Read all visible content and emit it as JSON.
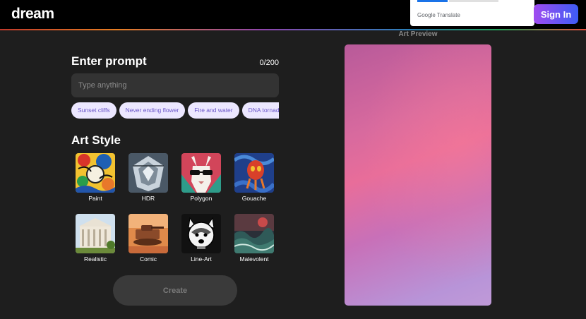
{
  "header": {
    "logo": "dream",
    "sign_in_label": "Sign In",
    "translate_popup": {
      "brand": "Google",
      "product": "Translate"
    }
  },
  "prompt": {
    "title": "Enter prompt",
    "counter": "0/200",
    "placeholder": "Type anything",
    "value": "",
    "suggestions": [
      "Sunset cliffs",
      "Never ending flower",
      "Fire and water",
      "DNA tornado"
    ]
  },
  "art_style": {
    "title": "Art Style",
    "styles": [
      {
        "label": "Paint",
        "icon": "paint-thumb"
      },
      {
        "label": "HDR",
        "icon": "hdr-thumb"
      },
      {
        "label": "Polygon",
        "icon": "polygon-thumb"
      },
      {
        "label": "Gouache",
        "icon": "gouache-thumb"
      },
      {
        "label": "Realistic",
        "icon": "realistic-thumb"
      },
      {
        "label": "Comic",
        "icon": "comic-thumb"
      },
      {
        "label": "Line-Art",
        "icon": "line-art-thumb"
      },
      {
        "label": "Malevolent",
        "icon": "malevolent-thumb"
      }
    ]
  },
  "create_label": "Create",
  "preview": {
    "label": "Art Preview"
  },
  "colors": {
    "background": "#1e1e1e",
    "chip_bg": "#ece7ff",
    "chip_text": "#6a56c9",
    "sign_in_gradient_start": "#a04cf0",
    "sign_in_gradient_end": "#3d5cf5",
    "create_disabled_bg": "#3a3a3a"
  }
}
